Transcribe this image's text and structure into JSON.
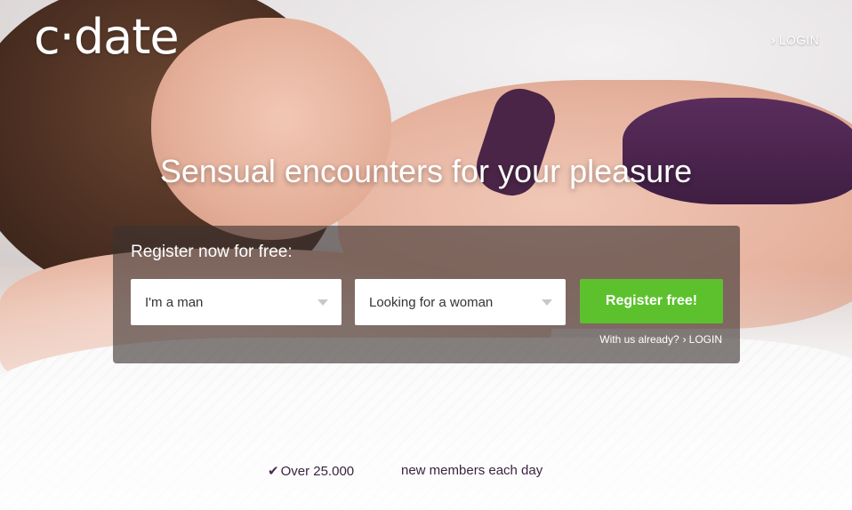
{
  "header": {
    "logo_text": "c·date",
    "login_label": "LOGIN"
  },
  "hero": {
    "headline": "Sensual encounters for your pleasure"
  },
  "register": {
    "title": "Register now for free:",
    "gender_value": "I'm a man",
    "seeking_value": "Looking for a woman",
    "button_label": "Register free!",
    "already_text": "With us already?",
    "already_login": "LOGIN"
  },
  "stats": {
    "members_count": "Over 25.000",
    "members_text": "new members each day"
  },
  "colors": {
    "register_button": "#5cc12d",
    "panel_bg": "rgba(60,50,48,0.62)",
    "stats_text": "#3b2340"
  },
  "icons": {
    "login_chevron": "chevron-right-icon",
    "select_caret": "caret-down-icon",
    "stats_check": "checkmark-icon"
  }
}
